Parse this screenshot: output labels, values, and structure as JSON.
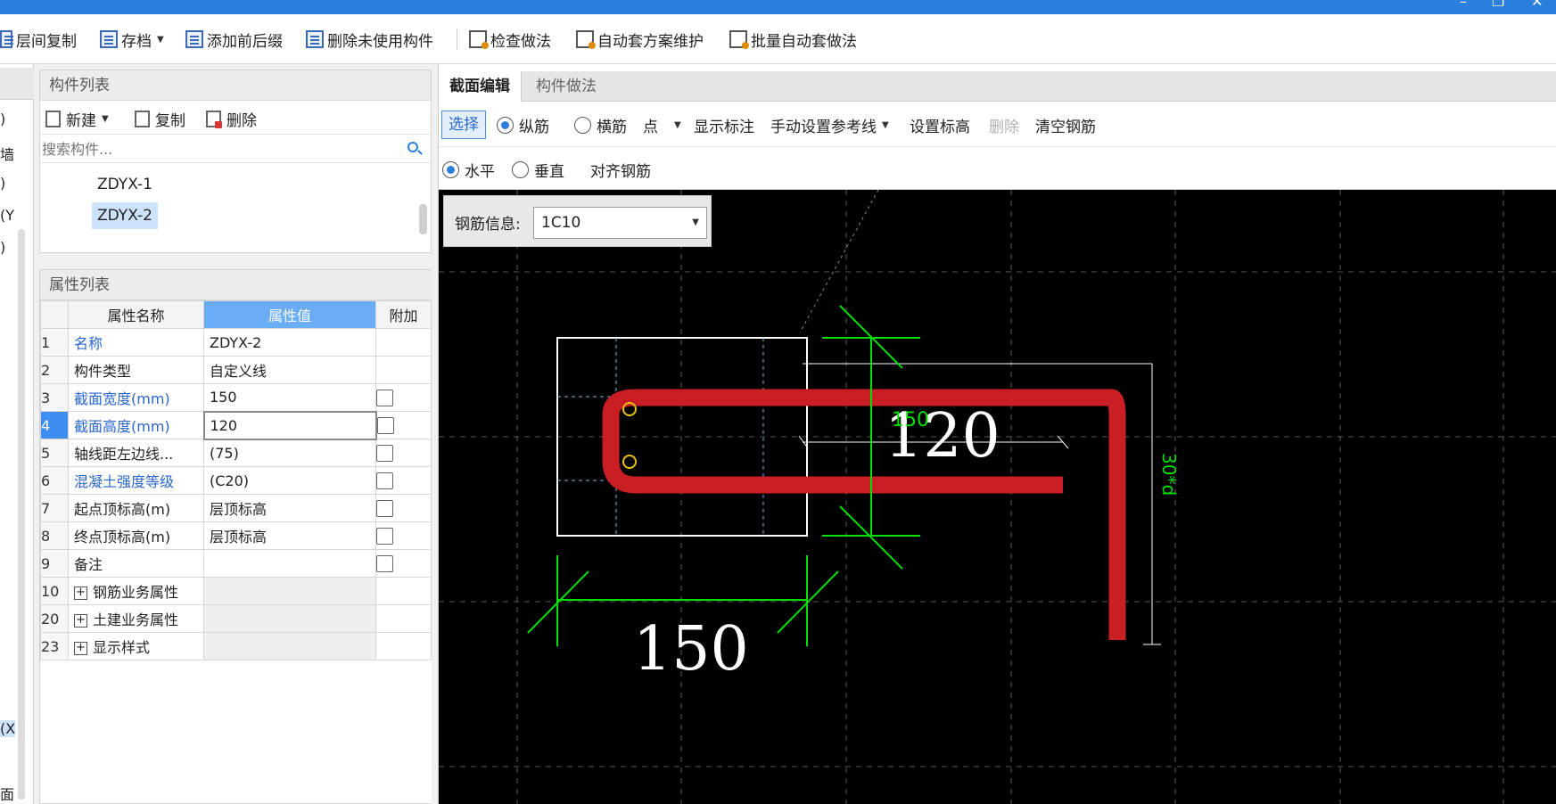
{
  "window": {
    "minimize": "–",
    "restore": "❐",
    "close": "✕"
  },
  "toolbar": {
    "copy_floors": "层间复制",
    "save": "存档",
    "add_prefix_suffix": "添加前后缀",
    "delete_unused": "删除未使用构件",
    "check_method": "检查做法",
    "auto_scheme": "自动套方案维护",
    "batch_auto": "批量自动套做法"
  },
  "left_strip": {
    "rows": [
      ")",
      "墙",
      ")",
      "(Y",
      ")",
      "(X",
      "面"
    ]
  },
  "component_list": {
    "title": "构件列表",
    "new": "新建",
    "copy": "复制",
    "delete": "删除",
    "search_placeholder": "搜索构件...",
    "items": [
      "ZDYX-1",
      "ZDYX-2"
    ]
  },
  "property_list": {
    "title": "属性列表",
    "headers": {
      "name": "属性名称",
      "value": "属性值",
      "extra": "附加"
    },
    "rows": [
      {
        "idx": "1",
        "name": "名称",
        "value": "ZDYX-2"
      },
      {
        "idx": "2",
        "name": "构件类型",
        "value": "自定义线"
      },
      {
        "idx": "3",
        "name": "截面宽度(mm)",
        "value": "150"
      },
      {
        "idx": "4",
        "name": "截面高度(mm)",
        "value": "120"
      },
      {
        "idx": "5",
        "name": "轴线距左边线...",
        "value": "(75)"
      },
      {
        "idx": "6",
        "name": "混凝土强度等级",
        "value": "(C20)"
      },
      {
        "idx": "7",
        "name": "起点顶标高(m)",
        "value": "层顶标高"
      },
      {
        "idx": "8",
        "name": "终点顶标高(m)",
        "value": "层顶标高"
      },
      {
        "idx": "9",
        "name": "备注",
        "value": ""
      },
      {
        "idx": "10",
        "name": "钢筋业务属性",
        "value": ""
      },
      {
        "idx": "20",
        "name": "土建业务属性",
        "value": ""
      },
      {
        "idx": "23",
        "name": "显示样式",
        "value": ""
      }
    ]
  },
  "editor": {
    "tabs": [
      "截面编辑",
      "构件做法"
    ],
    "toolbar1": {
      "select": "选择",
      "longitudinal": "纵筋",
      "transverse": "横筋",
      "point": "点",
      "show_annotation": "显示标注",
      "manual_ref_line": "手动设置参考线",
      "set_elevation": "设置标高",
      "delete": "删除",
      "clear_rebar": "清空钢筋"
    },
    "toolbar2": {
      "horizontal": "水平",
      "vertical": "垂直",
      "align_rebar": "对齐钢筋"
    },
    "rebar_info": {
      "label": "钢筋信息:",
      "value": "1C10"
    },
    "drawing": {
      "dim_width": "150",
      "dim_height": "120",
      "dim_small": "150",
      "dim_hook": "30*d"
    }
  },
  "colors": {
    "accent": "#2d7fde",
    "rebar": "#c81e24",
    "dimension": "#00e000",
    "canvas": "#000000"
  }
}
